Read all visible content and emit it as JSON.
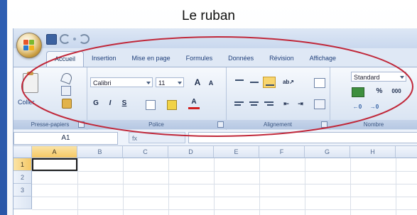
{
  "slide": {
    "title": "Le ruban"
  },
  "tabs": [
    {
      "label": "Accueil",
      "active": true
    },
    {
      "label": "Insertion"
    },
    {
      "label": "Mise en page"
    },
    {
      "label": "Formules"
    },
    {
      "label": "Données"
    },
    {
      "label": "Révision"
    },
    {
      "label": "Affichage"
    }
  ],
  "ribbon": {
    "clipboard": {
      "paste_label": "Coller",
      "group_label": "Presse-papiers"
    },
    "font": {
      "font_name": "Calibri",
      "font_size": "11",
      "grow_label": "A",
      "shrink_label": "A",
      "bold": "G",
      "italic": "I",
      "underline": "S",
      "group_label": "Police"
    },
    "alignment": {
      "group_label": "Alignement"
    },
    "number": {
      "format": "Standard",
      "percent": "%",
      "thousands": "000",
      "group_label": "Nombre"
    }
  },
  "formula_bar": {
    "name_box": "A1",
    "fx_label": "fx"
  },
  "sheet": {
    "columns": [
      "A",
      "B",
      "C",
      "D",
      "E",
      "F",
      "G",
      "H"
    ],
    "rows": [
      "1",
      "2",
      "3"
    ],
    "selected": "A1"
  },
  "colors": {
    "accent_highlight": "#c0283a",
    "selected_fill": "#f8d56e",
    "frame": "#2f5fb3"
  }
}
